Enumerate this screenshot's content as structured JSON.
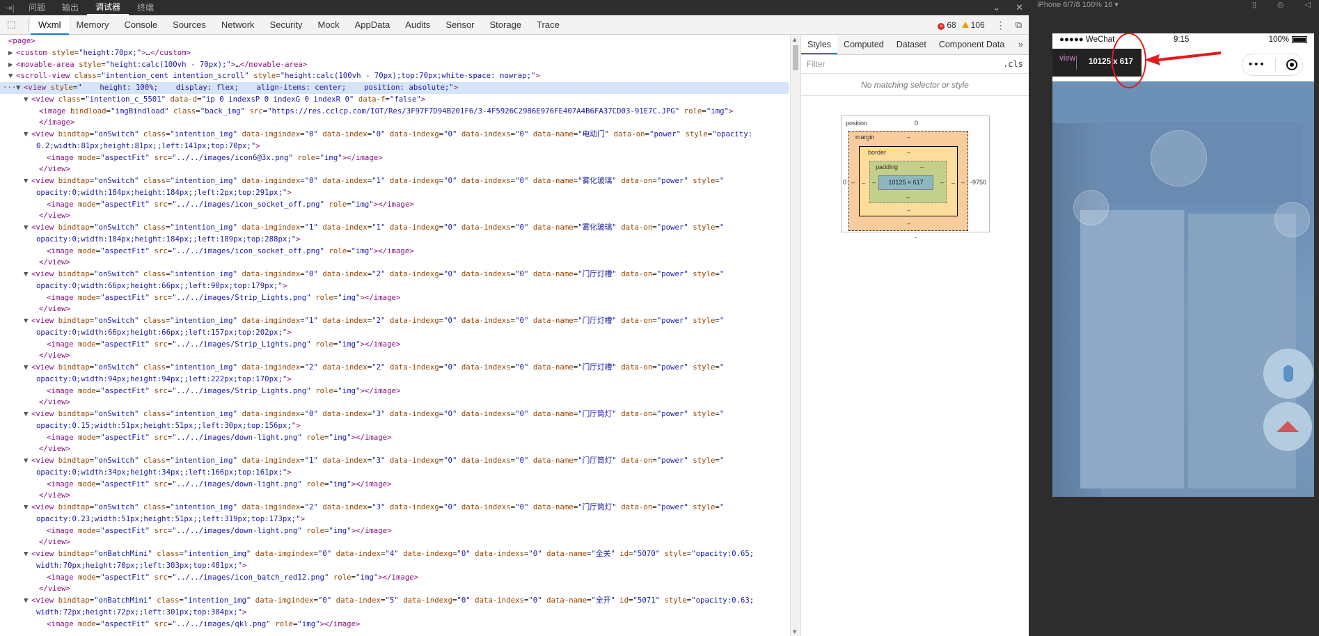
{
  "topbar": {
    "tabs": [
      {
        "label": "问题",
        "active": false
      },
      {
        "label": "输出",
        "active": false
      },
      {
        "label": "调试器",
        "active": true
      },
      {
        "label": "终端",
        "active": false
      }
    ]
  },
  "toolbar": {
    "tabs": [
      "Wxml",
      "Memory",
      "Console",
      "Sources",
      "Network",
      "Security",
      "Mock",
      "AppData",
      "Audits",
      "Sensor",
      "Storage",
      "Trace"
    ],
    "active_tab": "Wxml",
    "error_count": "68",
    "warning_count": "106",
    "more_label": "⋮"
  },
  "styles_panel": {
    "tabs": [
      "Styles",
      "Computed",
      "Dataset",
      "Component Data"
    ],
    "active_tab": "Styles",
    "more": "»",
    "filter_placeholder": "Filter",
    "cls_label": ".cls",
    "no_match": "No matching selector or style",
    "box_model": {
      "position_label": "position",
      "position_top": "0",
      "position_left": "0",
      "position_right": "-9750",
      "position_bottom": "-",
      "margin_label": "margin",
      "border_label": "border",
      "padding_label": "padding",
      "dash": "–",
      "content": "10125 × 617"
    }
  },
  "simulator": {
    "device": "iPhone 6/7/8 100% 16 ▾",
    "status_signal": "●●●●● WeChat",
    "status_time": "9:15",
    "status_battery": "100%",
    "capsule_dots": "•••",
    "tooltip_name": "view",
    "tooltip_size": "10125 x 617"
  },
  "wxml_lines": [
    {
      "indent": 0,
      "tri": "",
      "html": "<span class='tag'>&lt;page&gt;</span>"
    },
    {
      "indent": 1,
      "tri": "▶",
      "html": "<span class='tag'>&lt;custom</span> <span class='attr'>style</span>=<span class='val'>\"height:70px;\"</span><span class='tag'>&gt;</span>…<span class='tag'>&lt;/custom&gt;</span>"
    },
    {
      "indent": 1,
      "tri": "▶",
      "html": "<span class='tag'>&lt;movable-area</span> <span class='attr'>style</span>=<span class='val'>\"height:calc(100vh - 70px);\"</span><span class='tag'>&gt;</span>…<span class='tag'>&lt;/movable-area&gt;</span>"
    },
    {
      "indent": 1,
      "tri": "▼",
      "html": "<span class='tag'>&lt;scroll-view</span> <span class='attr'>class</span>=<span class='val'>\"intention_cent intention_scroll\"</span> <span class='attr'>style</span>=<span class='val'>\"height:calc(100vh - 70px);top:70px;white-space: nowrap;\"</span><span class='tag'>&gt;</span>"
    },
    {
      "indent": 2,
      "tri": "▼",
      "sel": true,
      "html": "<span class='tag'>&lt;view</span> <span class='attr'>style</span>=<span class='val'>\"    height: 100%;    display: flex;    align-items: center;    position: absolute;\"</span><span class='tag'>&gt;</span>"
    },
    {
      "indent": 3,
      "tri": "▼",
      "html": "<span class='tag'>&lt;view</span> <span class='attr'>class</span>=<span class='val'>\"intention_c_5501\"</span> <span class='attr'>data-d</span>=<span class='val'>\"ip 0 indexsP 0 indexG 0 indexR 0\"</span> <span class='attr'>data-f</span>=<span class='val'>\"false\"</span><span class='tag'>&gt;</span>"
    },
    {
      "indent": 4,
      "tri": "",
      "html": "<span class='tag'>&lt;image</span> <span class='attr'>bindload</span>=<span class='val'>\"imgBindload\"</span> <span class='attr'>class</span>=<span class='val'>\"back_img\"</span> <span class='attr'>src</span>=<span class='val'>\"https://res.cclcp.com/IOT/Res/3F97F7D94B201F6/3-4F5926C2986E976FE407A4B6FA37CD03-91E7C.JPG\"</span> <span class='attr'>role</span>=<span class='val'>\"img\"</span><span class='tag'>&gt;</span>"
    },
    {
      "indent": 4,
      "tri": "",
      "html": "<span class='tag'>&lt;/image&gt;</span>"
    },
    {
      "indent": 3,
      "tri": "▼",
      "html": "<span class='tag'>&lt;view</span> <span class='attr'>bindtap</span>=<span class='val'>\"onSwitch\"</span> <span class='attr'>class</span>=<span class='val'>\"intention_img\"</span> <span class='attr'>data-imgindex</span>=<span class='val'>\"0\"</span> <span class='attr'>data-index</span>=<span class='val'>\"0\"</span> <span class='attr'>data-indexg</span>=<span class='val'>\"0\"</span> <span class='attr'>data-indexs</span>=<span class='val'>\"0\"</span> <span class='attr'>data-name</span>=<span class='val'>\"电动门\"</span> <span class='attr'>data-on</span>=<span class='val'>\"power\"</span> <span class='attr'>style</span>=<span class='val'>\"opacity:</span>"
    },
    {
      "indent": 0,
      "tri": "",
      "wrap": true,
      "html": "<span class='val'>0.2;width:81px;height:81px;;left:141px;top:70px;\"</span><span class='tag'>&gt;</span>"
    },
    {
      "indent": 5,
      "tri": "",
      "html": "<span class='tag'>&lt;image</span> <span class='attr'>mode</span>=<span class='val'>\"aspectFit\"</span> <span class='attr'>src</span>=<span class='val'>\"../../images/icon6@3x.png\"</span> <span class='attr'>role</span>=<span class='val'>\"img\"</span><span class='tag'>&gt;&lt;/image&gt;</span>"
    },
    {
      "indent": 4,
      "tri": "",
      "html": "<span class='tag'>&lt;/view&gt;</span>"
    },
    {
      "indent": 3,
      "tri": "▼",
      "html": "<span class='tag'>&lt;view</span> <span class='attr'>bindtap</span>=<span class='val'>\"onSwitch\"</span> <span class='attr'>class</span>=<span class='val'>\"intention_img\"</span> <span class='attr'>data-imgindex</span>=<span class='val'>\"0\"</span> <span class='attr'>data-index</span>=<span class='val'>\"1\"</span> <span class='attr'>data-indexg</span>=<span class='val'>\"0\"</span> <span class='attr'>data-indexs</span>=<span class='val'>\"0\"</span> <span class='attr'>data-name</span>=<span class='val'>\"雾化玻璃\"</span> <span class='attr'>data-on</span>=<span class='val'>\"power\"</span> <span class='attr'>style</span>=<span class='val'>\"</span>"
    },
    {
      "indent": 0,
      "tri": "",
      "wrap": true,
      "html": "<span class='val'>opacity:0;width:184px;height:184px;;left:2px;top:291px;\"</span><span class='tag'>&gt;</span>"
    },
    {
      "indent": 5,
      "tri": "",
      "html": "<span class='tag'>&lt;image</span> <span class='attr'>mode</span>=<span class='val'>\"aspectFit\"</span> <span class='attr'>src</span>=<span class='val'>\"../../images/icon_socket_off.png\"</span> <span class='attr'>role</span>=<span class='val'>\"img\"</span><span class='tag'>&gt;&lt;/image&gt;</span>"
    },
    {
      "indent": 4,
      "tri": "",
      "html": "<span class='tag'>&lt;/view&gt;</span>"
    },
    {
      "indent": 3,
      "tri": "▼",
      "html": "<span class='tag'>&lt;view</span> <span class='attr'>bindtap</span>=<span class='val'>\"onSwitch\"</span> <span class='attr'>class</span>=<span class='val'>\"intention_img\"</span> <span class='attr'>data-imgindex</span>=<span class='val'>\"1\"</span> <span class='attr'>data-index</span>=<span class='val'>\"1\"</span> <span class='attr'>data-indexg</span>=<span class='val'>\"0\"</span> <span class='attr'>data-indexs</span>=<span class='val'>\"0\"</span> <span class='attr'>data-name</span>=<span class='val'>\"雾化玻璃\"</span> <span class='attr'>data-on</span>=<span class='val'>\"power\"</span> <span class='attr'>style</span>=<span class='val'>\"</span>"
    },
    {
      "indent": 0,
      "tri": "",
      "wrap": true,
      "html": "<span class='val'>opacity:0;width:184px;height:184px;;left:189px;top:288px;\"</span><span class='tag'>&gt;</span>"
    },
    {
      "indent": 5,
      "tri": "",
      "html": "<span class='tag'>&lt;image</span> <span class='attr'>mode</span>=<span class='val'>\"aspectFit\"</span> <span class='attr'>src</span>=<span class='val'>\"../../images/icon_socket_off.png\"</span> <span class='attr'>role</span>=<span class='val'>\"img\"</span><span class='tag'>&gt;&lt;/image&gt;</span>"
    },
    {
      "indent": 4,
      "tri": "",
      "html": "<span class='tag'>&lt;/view&gt;</span>"
    },
    {
      "indent": 3,
      "tri": "▼",
      "html": "<span class='tag'>&lt;view</span> <span class='attr'>bindtap</span>=<span class='val'>\"onSwitch\"</span> <span class='attr'>class</span>=<span class='val'>\"intention_img\"</span> <span class='attr'>data-imgindex</span>=<span class='val'>\"0\"</span> <span class='attr'>data-index</span>=<span class='val'>\"2\"</span> <span class='attr'>data-indexg</span>=<span class='val'>\"0\"</span> <span class='attr'>data-indexs</span>=<span class='val'>\"0\"</span> <span class='attr'>data-name</span>=<span class='val'>\"门厅灯槽\"</span> <span class='attr'>data-on</span>=<span class='val'>\"power\"</span> <span class='attr'>style</span>=<span class='val'>\"</span>"
    },
    {
      "indent": 0,
      "tri": "",
      "wrap": true,
      "html": "<span class='val'>opacity:0;width:66px;height:66px;;left:90px;top:179px;\"</span><span class='tag'>&gt;</span>"
    },
    {
      "indent": 5,
      "tri": "",
      "html": "<span class='tag'>&lt;image</span> <span class='attr'>mode</span>=<span class='val'>\"aspectFit\"</span> <span class='attr'>src</span>=<span class='val'>\"../../images/Strip_Lights.png\"</span> <span class='attr'>role</span>=<span class='val'>\"img\"</span><span class='tag'>&gt;&lt;/image&gt;</span>"
    },
    {
      "indent": 4,
      "tri": "",
      "html": "<span class='tag'>&lt;/view&gt;</span>"
    },
    {
      "indent": 3,
      "tri": "▼",
      "html": "<span class='tag'>&lt;view</span> <span class='attr'>bindtap</span>=<span class='val'>\"onSwitch\"</span> <span class='attr'>class</span>=<span class='val'>\"intention_img\"</span> <span class='attr'>data-imgindex</span>=<span class='val'>\"1\"</span> <span class='attr'>data-index</span>=<span class='val'>\"2\"</span> <span class='attr'>data-indexg</span>=<span class='val'>\"0\"</span> <span class='attr'>data-indexs</span>=<span class='val'>\"0\"</span> <span class='attr'>data-name</span>=<span class='val'>\"门厅灯槽\"</span> <span class='attr'>data-on</span>=<span class='val'>\"power\"</span> <span class='attr'>style</span>=<span class='val'>\"</span>"
    },
    {
      "indent": 0,
      "tri": "",
      "wrap": true,
      "html": "<span class='val'>opacity:0;width:66px;height:66px;;left:157px;top:202px;\"</span><span class='tag'>&gt;</span>"
    },
    {
      "indent": 5,
      "tri": "",
      "html": "<span class='tag'>&lt;image</span> <span class='attr'>mode</span>=<span class='val'>\"aspectFit\"</span> <span class='attr'>src</span>=<span class='val'>\"../../images/Strip_Lights.png\"</span> <span class='attr'>role</span>=<span class='val'>\"img\"</span><span class='tag'>&gt;&lt;/image&gt;</span>"
    },
    {
      "indent": 4,
      "tri": "",
      "html": "<span class='tag'>&lt;/view&gt;</span>"
    },
    {
      "indent": 3,
      "tri": "▼",
      "html": "<span class='tag'>&lt;view</span> <span class='attr'>bindtap</span>=<span class='val'>\"onSwitch\"</span> <span class='attr'>class</span>=<span class='val'>\"intention_img\"</span> <span class='attr'>data-imgindex</span>=<span class='val'>\"2\"</span> <span class='attr'>data-index</span>=<span class='val'>\"2\"</span> <span class='attr'>data-indexg</span>=<span class='val'>\"0\"</span> <span class='attr'>data-indexs</span>=<span class='val'>\"0\"</span> <span class='attr'>data-name</span>=<span class='val'>\"门厅灯槽\"</span> <span class='attr'>data-on</span>=<span class='val'>\"power\"</span> <span class='attr'>style</span>=<span class='val'>\"</span>"
    },
    {
      "indent": 0,
      "tri": "",
      "wrap": true,
      "html": "<span class='val'>opacity:0;width:94px;height:94px;;left:222px;top:170px;\"</span><span class='tag'>&gt;</span>"
    },
    {
      "indent": 5,
      "tri": "",
      "html": "<span class='tag'>&lt;image</span> <span class='attr'>mode</span>=<span class='val'>\"aspectFit\"</span> <span class='attr'>src</span>=<span class='val'>\"../../images/Strip_Lights.png\"</span> <span class='attr'>role</span>=<span class='val'>\"img\"</span><span class='tag'>&gt;&lt;/image&gt;</span>"
    },
    {
      "indent": 4,
      "tri": "",
      "html": "<span class='tag'>&lt;/view&gt;</span>"
    },
    {
      "indent": 3,
      "tri": "▼",
      "html": "<span class='tag'>&lt;view</span> <span class='attr'>bindtap</span>=<span class='val'>\"onSwitch\"</span> <span class='attr'>class</span>=<span class='val'>\"intention_img\"</span> <span class='attr'>data-imgindex</span>=<span class='val'>\"0\"</span> <span class='attr'>data-index</span>=<span class='val'>\"3\"</span> <span class='attr'>data-indexg</span>=<span class='val'>\"0\"</span> <span class='attr'>data-indexs</span>=<span class='val'>\"0\"</span> <span class='attr'>data-name</span>=<span class='val'>\"门厅筒灯\"</span> <span class='attr'>data-on</span>=<span class='val'>\"power\"</span> <span class='attr'>style</span>=<span class='val'>\"</span>"
    },
    {
      "indent": 0,
      "tri": "",
      "wrap": true,
      "html": "<span class='val'>opacity:0.15;width:51px;height:51px;;left:30px;top:156px;\"</span><span class='tag'>&gt;</span>"
    },
    {
      "indent": 5,
      "tri": "",
      "html": "<span class='tag'>&lt;image</span> <span class='attr'>mode</span>=<span class='val'>\"aspectFit\"</span> <span class='attr'>src</span>=<span class='val'>\"../../images/down-light.png\"</span> <span class='attr'>role</span>=<span class='val'>\"img\"</span><span class='tag'>&gt;&lt;/image&gt;</span>"
    },
    {
      "indent": 4,
      "tri": "",
      "html": "<span class='tag'>&lt;/view&gt;</span>"
    },
    {
      "indent": 3,
      "tri": "▼",
      "html": "<span class='tag'>&lt;view</span> <span class='attr'>bindtap</span>=<span class='val'>\"onSwitch\"</span> <span class='attr'>class</span>=<span class='val'>\"intention_img\"</span> <span class='attr'>data-imgindex</span>=<span class='val'>\"1\"</span> <span class='attr'>data-index</span>=<span class='val'>\"3\"</span> <span class='attr'>data-indexg</span>=<span class='val'>\"0\"</span> <span class='attr'>data-indexs</span>=<span class='val'>\"0\"</span> <span class='attr'>data-name</span>=<span class='val'>\"门厅筒灯\"</span> <span class='attr'>data-on</span>=<span class='val'>\"power\"</span> <span class='attr'>style</span>=<span class='val'>\"</span>"
    },
    {
      "indent": 0,
      "tri": "",
      "wrap": true,
      "html": "<span class='val'>opacity:0;width:34px;height:34px;;left:166px;top:161px;\"</span><span class='tag'>&gt;</span>"
    },
    {
      "indent": 5,
      "tri": "",
      "html": "<span class='tag'>&lt;image</span> <span class='attr'>mode</span>=<span class='val'>\"aspectFit\"</span> <span class='attr'>src</span>=<span class='val'>\"../../images/down-light.png\"</span> <span class='attr'>role</span>=<span class='val'>\"img\"</span><span class='tag'>&gt;&lt;/image&gt;</span>"
    },
    {
      "indent": 4,
      "tri": "",
      "html": "<span class='tag'>&lt;/view&gt;</span>"
    },
    {
      "indent": 3,
      "tri": "▼",
      "html": "<span class='tag'>&lt;view</span> <span class='attr'>bindtap</span>=<span class='val'>\"onSwitch\"</span> <span class='attr'>class</span>=<span class='val'>\"intention_img\"</span> <span class='attr'>data-imgindex</span>=<span class='val'>\"2\"</span> <span class='attr'>data-index</span>=<span class='val'>\"3\"</span> <span class='attr'>data-indexg</span>=<span class='val'>\"0\"</span> <span class='attr'>data-indexs</span>=<span class='val'>\"0\"</span> <span class='attr'>data-name</span>=<span class='val'>\"门厅筒灯\"</span> <span class='attr'>data-on</span>=<span class='val'>\"power\"</span> <span class='attr'>style</span>=<span class='val'>\"</span>"
    },
    {
      "indent": 0,
      "tri": "",
      "wrap": true,
      "html": "<span class='val'>opacity:0.23;width:51px;height:51px;;left:319px;top:173px;\"</span><span class='tag'>&gt;</span>"
    },
    {
      "indent": 5,
      "tri": "",
      "html": "<span class='tag'>&lt;image</span> <span class='attr'>mode</span>=<span class='val'>\"aspectFit\"</span> <span class='attr'>src</span>=<span class='val'>\"../../images/down-light.png\"</span> <span class='attr'>role</span>=<span class='val'>\"img\"</span><span class='tag'>&gt;&lt;/image&gt;</span>"
    },
    {
      "indent": 4,
      "tri": "",
      "html": "<span class='tag'>&lt;/view&gt;</span>"
    },
    {
      "indent": 3,
      "tri": "▼",
      "html": "<span class='tag'>&lt;view</span> <span class='attr'>bindtap</span>=<span class='val'>\"onBatchMini\"</span> <span class='attr'>class</span>=<span class='val'>\"intention_img\"</span> <span class='attr'>data-imgindex</span>=<span class='val'>\"0\"</span> <span class='attr'>data-index</span>=<span class='val'>\"4\"</span> <span class='attr'>data-indexg</span>=<span class='val'>\"0\"</span> <span class='attr'>data-indexs</span>=<span class='val'>\"0\"</span> <span class='attr'>data-name</span>=<span class='val'>\"全关\"</span> <span class='attr'>id</span>=<span class='val'>\"5070\"</span> <span class='attr'>style</span>=<span class='val'>\"opacity:0.65;</span>"
    },
    {
      "indent": 0,
      "tri": "",
      "wrap": true,
      "html": "<span class='val'>width:70px;height:70px;;left:303px;top:481px;\"</span><span class='tag'>&gt;</span>"
    },
    {
      "indent": 5,
      "tri": "",
      "html": "<span class='tag'>&lt;image</span> <span class='attr'>mode</span>=<span class='val'>\"aspectFit\"</span> <span class='attr'>src</span>=<span class='val'>\"../../images/icon_batch_red12.png\"</span> <span class='attr'>role</span>=<span class='val'>\"img\"</span><span class='tag'>&gt;&lt;/image&gt;</span>"
    },
    {
      "indent": 4,
      "tri": "",
      "html": "<span class='tag'>&lt;/view&gt;</span>"
    },
    {
      "indent": 3,
      "tri": "▼",
      "html": "<span class='tag'>&lt;view</span> <span class='attr'>bindtap</span>=<span class='val'>\"onBatchMini\"</span> <span class='attr'>class</span>=<span class='val'>\"intention_img\"</span> <span class='attr'>data-imgindex</span>=<span class='val'>\"0\"</span> <span class='attr'>data-index</span>=<span class='val'>\"5\"</span> <span class='attr'>data-indexg</span>=<span class='val'>\"0\"</span> <span class='attr'>data-indexs</span>=<span class='val'>\"0\"</span> <span class='attr'>data-name</span>=<span class='val'>\"全开\"</span> <span class='attr'>id</span>=<span class='val'>\"5071\"</span> <span class='attr'>style</span>=<span class='val'>\"opacity:0.63;</span>"
    },
    {
      "indent": 0,
      "tri": "",
      "wrap": true,
      "html": "<span class='val'>width:72px;height:72px;;left:301px;top:384px;\"</span><span class='tag'>&gt;</span>"
    },
    {
      "indent": 5,
      "tri": "",
      "html": "<span class='tag'>&lt;image</span> <span class='attr'>mode</span>=<span class='val'>\"aspectFit\"</span> <span class='attr'>src</span>=<span class='val'>\"../../images/qkl.png\"</span> <span class='attr'>role</span>=<span class='val'>\"img\"</span><span class='tag'>&gt;&lt;/image&gt;</span>"
    }
  ]
}
